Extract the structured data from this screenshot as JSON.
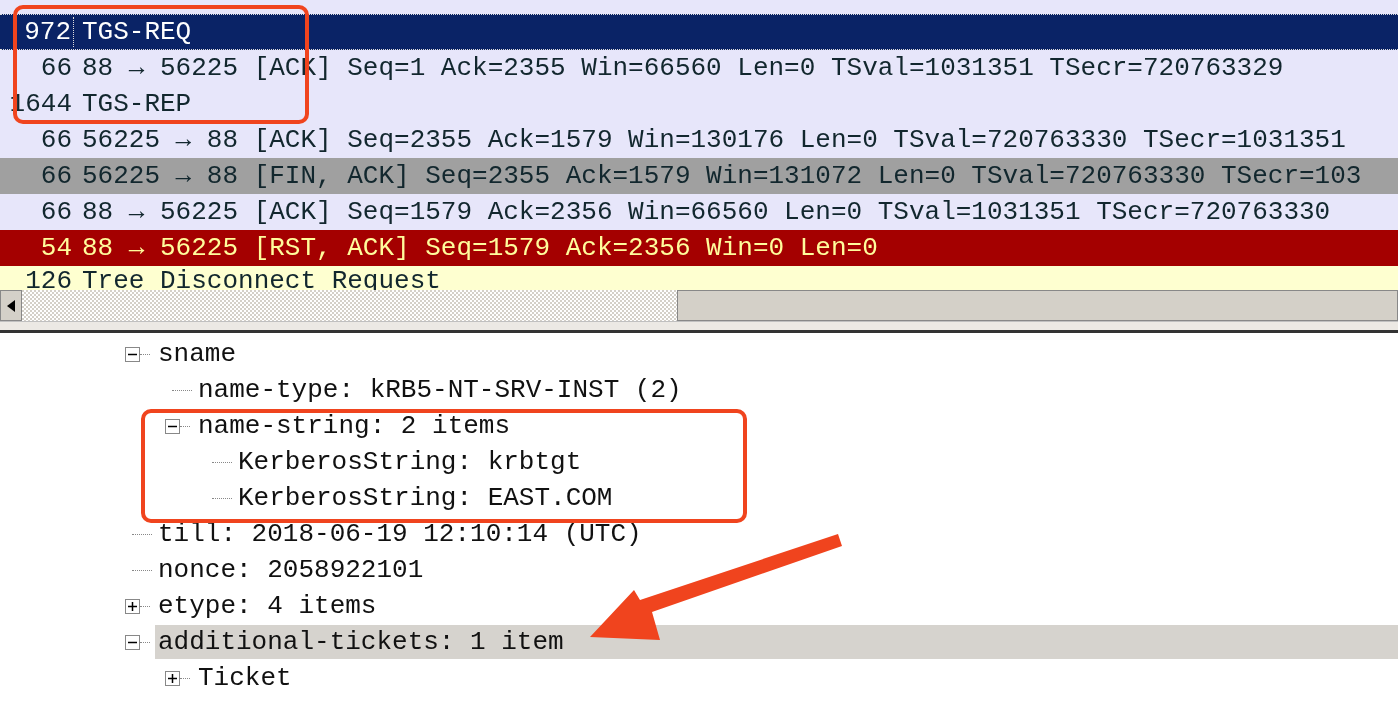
{
  "packet_list": {
    "rows": [
      {
        "length": "972",
        "info": "TGS-REQ",
        "kind": "kerberos",
        "selected": true
      },
      {
        "length": "66",
        "info": "88 → 56225 [ACK] Seq=1 Ack=2355 Win=66560 Len=0 TSval=1031351 TSecr=720763329",
        "kind": "tcp",
        "selected": false
      },
      {
        "length": "1644",
        "info": "TGS-REP",
        "kind": "kerberos",
        "selected": false
      },
      {
        "length": "66",
        "info": "56225 → 88 [ACK] Seq=2355 Ack=1579 Win=130176 Len=0 TSval=720763330 TSecr=1031351",
        "kind": "tcp",
        "selected": false
      },
      {
        "length": "66",
        "info": "56225 → 88 [FIN, ACK] Seq=2355 Ack=1579 Win=131072 Len=0 TSval=720763330 TSecr=103",
        "kind": "fin",
        "selected": false
      },
      {
        "length": "66",
        "info": "88 → 56225 [ACK] Seq=1579 Ack=2356 Win=66560 Len=0 TSval=1031351 TSecr=720763330",
        "kind": "tcp",
        "selected": false
      },
      {
        "length": "54",
        "info": "88 → 56225 [RST, ACK] Seq=1579 Ack=2356 Win=0 Len=0",
        "kind": "rst",
        "selected": false
      },
      {
        "length": "126",
        "info": "Tree Disconnect Request",
        "kind": "smb",
        "selected": false
      }
    ]
  },
  "packet_details": {
    "items": [
      {
        "label": "sname",
        "expanded": true,
        "selected": false,
        "children": [
          {
            "label": "name-type: kRB5-NT-SRV-INST (2)",
            "selected": false
          },
          {
            "label": "name-string: 2 items",
            "expanded": true,
            "selected": false,
            "children": [
              {
                "label": "KerberosString: krbtgt",
                "selected": false
              },
              {
                "label": "KerberosString: EAST.COM",
                "selected": false
              }
            ]
          }
        ]
      },
      {
        "label": "till: 2018-06-19 12:10:14 (UTC)",
        "selected": false
      },
      {
        "label": "nonce: 2058922101",
        "selected": false
      },
      {
        "label": "etype: 4 items",
        "expanded": false,
        "selected": false
      },
      {
        "label": "additional-tickets: 1 item",
        "expanded": true,
        "selected": true,
        "children": [
          {
            "label": "Ticket",
            "expanded": false,
            "selected": false
          }
        ]
      }
    ]
  }
}
